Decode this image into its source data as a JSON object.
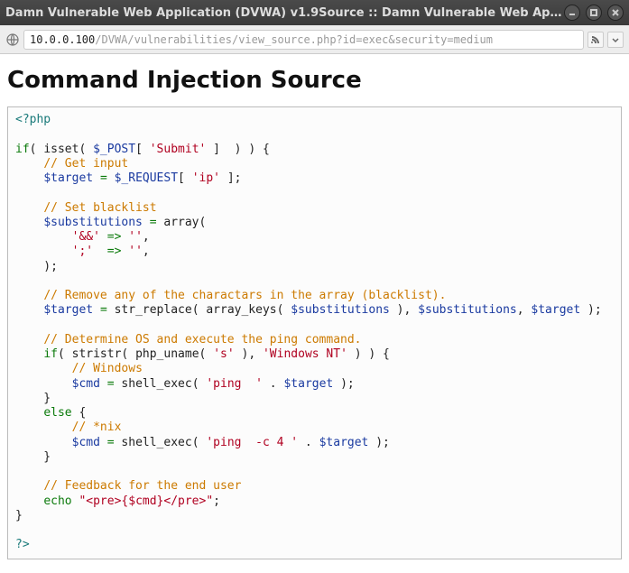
{
  "window": {
    "title": "Damn Vulnerable Web Application (DVWA) v1.9Source :: Damn Vulnerable Web App..."
  },
  "addressbar": {
    "host": "10.0.0.100",
    "path": "/DVWA/vulnerabilities/view_source.php?id=exec&security=medium"
  },
  "page": {
    "heading": "Command Injection Source"
  },
  "code": {
    "open_tag": "<?php",
    "close_tag": "?>",
    "kw_if": "if",
    "kw_else": "else",
    "kw_echo": "echo",
    "fn_isset": "isset",
    "fn_array": "array",
    "fn_str_replace": "str_replace",
    "fn_array_keys": "array_keys",
    "fn_stristr": "stristr",
    "fn_php_uname": "php_uname",
    "fn_shell_exec": "shell_exec",
    "var_post": "$_POST",
    "var_request": "$_REQUEST",
    "var_target": "$target",
    "var_subs": "$substitutions",
    "var_cmd": "$cmd",
    "str_submit": "'Submit'",
    "str_ip": "'ip'",
    "str_amp": "'&&'",
    "str_semi": "';'",
    "str_empty1": "''",
    "str_empty2": "''",
    "str_s": "'s'",
    "str_winnt": "'Windows NT'",
    "str_ping": "'ping  '",
    "str_pingc4": "'ping  -c 4 '",
    "str_pre": "\"<pre>{$cmd}</pre>\"",
    "com_getinput": "// Get input",
    "com_setbl": "// Set blacklist",
    "com_remove": "// Remove any of the charactars in the array (blacklist).",
    "com_detos": "// Determine OS and execute the ping command.",
    "com_win": "// Windows",
    "com_nix": "// *nix",
    "com_feedback": "// Feedback for the end user",
    "arrow": "=>",
    "assign": "="
  }
}
